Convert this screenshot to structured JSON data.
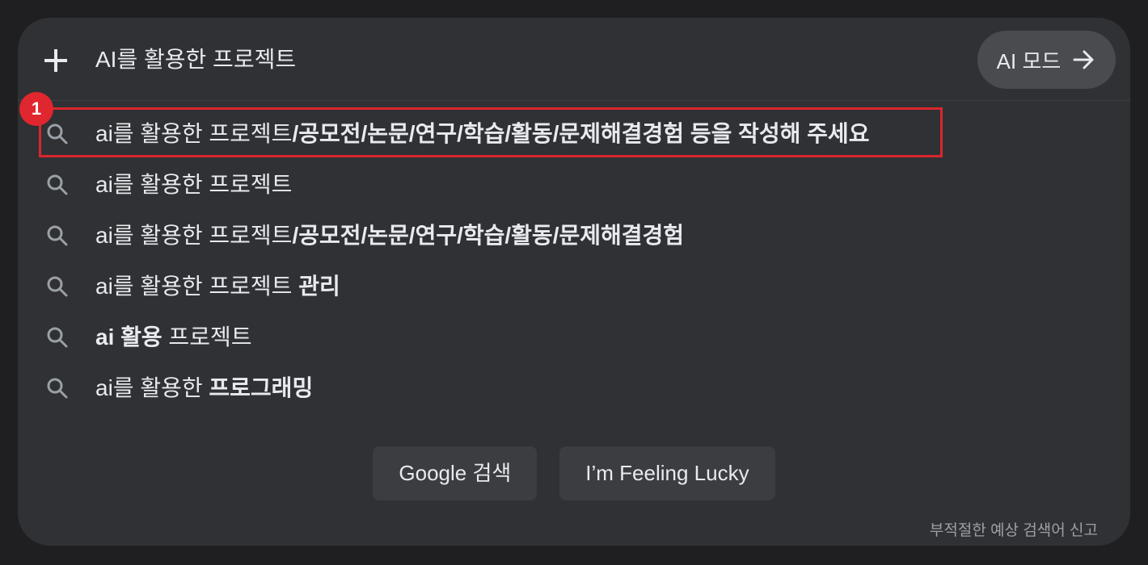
{
  "search": {
    "query": "AI를 활용한 프로젝트",
    "ai_mode_label": "AI 모드"
  },
  "marker": {
    "label": "1"
  },
  "suggestions": [
    {
      "normal": "ai를 활용한 프로젝트",
      "bold": "/공모전/논문/연구/학습/활동/문제해결경험 등을 작성해 주세요",
      "lead_bold": "",
      "tail_normal": ""
    },
    {
      "normal": "ai를 활용한 프로젝트",
      "bold": "",
      "lead_bold": "",
      "tail_normal": ""
    },
    {
      "normal": "ai를 활용한 프로젝트",
      "bold": "/공모전/논문/연구/학습/활동/문제해결경험",
      "lead_bold": "",
      "tail_normal": ""
    },
    {
      "normal": "ai를 활용한 프로젝트 ",
      "bold": "관리",
      "lead_bold": "",
      "tail_normal": ""
    },
    {
      "normal": "",
      "bold": "",
      "lead_bold": "ai 활용",
      "tail_normal": " 프로젝트"
    },
    {
      "normal": "ai를 활용한 ",
      "bold": "프로그래밍",
      "lead_bold": "",
      "tail_normal": ""
    }
  ],
  "buttons": {
    "google_search": "Google 검색",
    "feeling_lucky": "I’m Feeling Lucky"
  },
  "footer": {
    "report": "부적절한 예상 검색어 신고"
  }
}
